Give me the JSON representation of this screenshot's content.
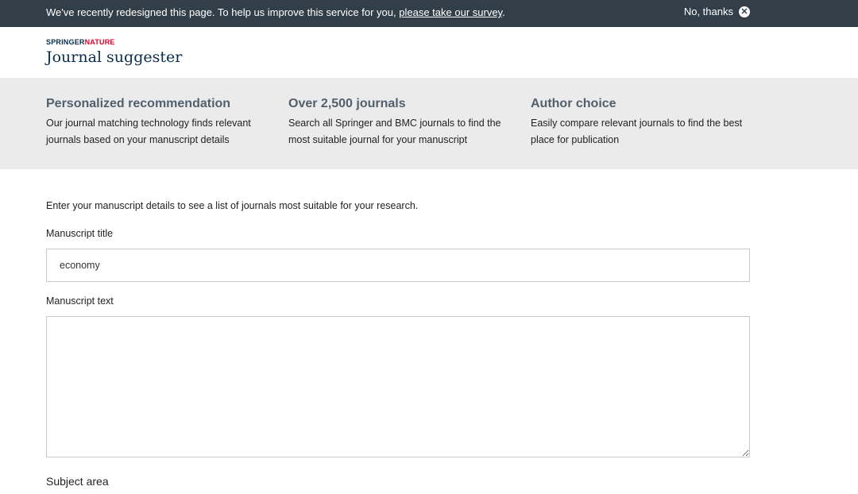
{
  "survey_bar": {
    "message": "We've recently redesigned this page. To help us improve this service for you,",
    "link_text": "please take our survey",
    "link_suffix": ".",
    "dismiss_label": "No, thanks",
    "dismiss_icon": "close-circle-icon"
  },
  "header": {
    "logo_part1": "SPRINGER",
    "logo_part2": "NATURE",
    "title": "Journal suggester"
  },
  "features": [
    {
      "title": "Personalized recommendation",
      "line1": "Our journal matching technology finds relevant",
      "line2": "journals based on your manuscript details"
    },
    {
      "title": "Over 2,500 journals",
      "line1": "Search all Springer and BMC journals to find the",
      "line2": "most suitable journal for your manuscript"
    },
    {
      "title": "Author choice",
      "line1": "Easily compare relevant journals to find the best",
      "line2": "place for publication"
    }
  ],
  "form": {
    "intro": "Enter your manuscript details to see a list of journals most suitable for your research.",
    "title_label": "Manuscript title",
    "title_value": "economy",
    "text_label": "Manuscript text",
    "text_value": "",
    "subject_label": "Subject area"
  },
  "colors": {
    "survey_bar_bg": "#333f48",
    "brand_navy": "#0a2d4f",
    "brand_red": "#e4002b",
    "features_bg": "#ebebeb",
    "feature_title": "#52606d"
  }
}
